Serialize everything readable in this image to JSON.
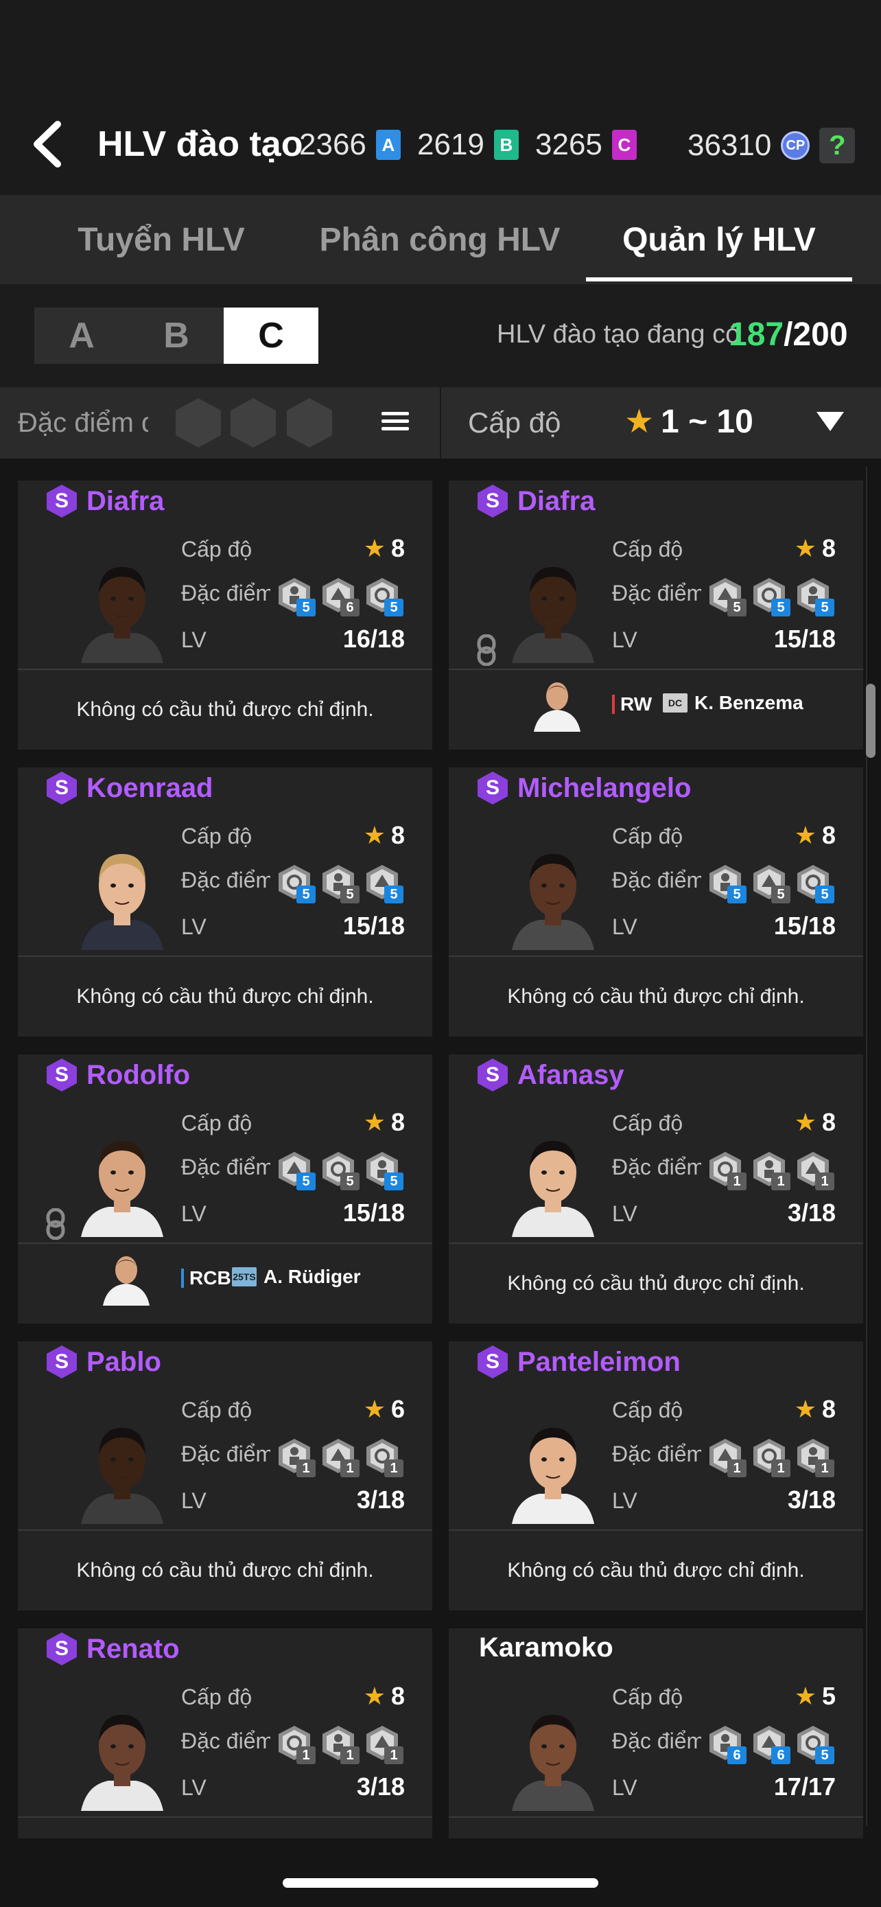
{
  "header": {
    "title": "HLV đào tạo",
    "currencies": [
      {
        "value": "2366",
        "badge": "A"
      },
      {
        "value": "2619",
        "badge": "B"
      },
      {
        "value": "3265",
        "badge": "C"
      },
      {
        "value": "36310",
        "badge": "CP"
      }
    ],
    "help_label": "?"
  },
  "tabs": [
    {
      "label": "Tuyển HLV",
      "active": false
    },
    {
      "label": "Phân công HLV",
      "active": false
    },
    {
      "label": "Quản lý HLV",
      "active": true
    }
  ],
  "grades": [
    {
      "label": "A",
      "active": false
    },
    {
      "label": "B",
      "active": false
    },
    {
      "label": "C",
      "active": true
    }
  ],
  "coach_count": {
    "label": "HLV đào tạo đang có",
    "current": "187",
    "max": "/200"
  },
  "filter": {
    "trait_label": "Đặc điểm đ",
    "level_label": "Cấp độ",
    "level_range": "1 ~ 10"
  },
  "labels": {
    "level": "Cấp độ",
    "trait": "Đặc điểm",
    "lv": "LV",
    "no_player": "Không có cầu thủ được chỉ định."
  },
  "coaches": [
    {
      "name": "Diafra",
      "rank": "S",
      "level": "8",
      "lv": "16/18",
      "traits": [
        "5",
        "6",
        "5"
      ],
      "trait_hi": [
        true,
        false,
        true
      ],
      "assigned": null
    },
    {
      "name": "Diafra",
      "rank": "S",
      "level": "8",
      "lv": "15/18",
      "traits": [
        "5",
        "5",
        "5"
      ],
      "trait_hi": [
        false,
        true,
        true
      ],
      "assigned": {
        "position": "RW",
        "club": "DC",
        "player": "K. Benzema"
      }
    },
    {
      "name": "Koenraad",
      "rank": "S",
      "level": "8",
      "lv": "15/18",
      "traits": [
        "5",
        "5",
        "5"
      ],
      "trait_hi": [
        true,
        false,
        true
      ],
      "assigned": null
    },
    {
      "name": "Michelangelo",
      "rank": "S",
      "level": "8",
      "lv": "15/18",
      "traits": [
        "5",
        "5",
        "5"
      ],
      "trait_hi": [
        true,
        false,
        true
      ],
      "assigned": null
    },
    {
      "name": "Rodolfo",
      "rank": "S",
      "level": "8",
      "lv": "15/18",
      "traits": [
        "5",
        "5",
        "5"
      ],
      "trait_hi": [
        true,
        false,
        true
      ],
      "assigned": {
        "position": "RCB",
        "club": "25TS",
        "player": "A. Rüdiger"
      }
    },
    {
      "name": "Afanasy",
      "rank": "S",
      "level": "8",
      "lv": "3/18",
      "traits": [
        "1",
        "1",
        "1"
      ],
      "trait_hi": [
        false,
        false,
        false
      ],
      "assigned": null
    },
    {
      "name": "Pablo",
      "rank": "S",
      "level": "6",
      "lv": "3/18",
      "traits": [
        "1",
        "1",
        "1"
      ],
      "trait_hi": [
        false,
        false,
        false
      ],
      "assigned": null
    },
    {
      "name": "Panteleimon",
      "rank": "S",
      "level": "8",
      "lv": "3/18",
      "traits": [
        "1",
        "1",
        "1"
      ],
      "trait_hi": [
        false,
        false,
        false
      ],
      "assigned": null
    },
    {
      "name": "Renato",
      "rank": "S",
      "level": "8",
      "lv": "3/18",
      "traits": [
        "1",
        "1",
        "1"
      ],
      "trait_hi": [
        false,
        false,
        false
      ],
      "assigned": null
    },
    {
      "name": "Karamoko",
      "rank": "",
      "level": "5",
      "lv": "17/17",
      "traits": [
        "6",
        "6",
        "5"
      ],
      "trait_hi": [
        true,
        true,
        true
      ],
      "assigned": null
    }
  ],
  "colors": {
    "accent_purple": "#b35cff",
    "accent_green": "#3fe072",
    "star": "#f2b21f",
    "trait_hi": "#1b86e0"
  }
}
